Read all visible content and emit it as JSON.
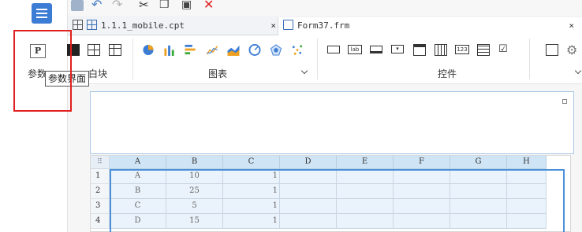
{
  "left_panel": {
    "param_button_glyph": "P",
    "param_label": "参数",
    "tooltip": "参数界面"
  },
  "top_toolbar": {
    "icons": [
      "save-icon",
      "undo-icon",
      "redo-icon",
      "cut-icon",
      "copy-icon",
      "paste-icon",
      "delete-icon"
    ]
  },
  "tabs": [
    {
      "label": "1.1.1_mobile.cpt",
      "close": "×"
    },
    {
      "label": "Form37.frm",
      "close": "×"
    }
  ],
  "ribbon": {
    "groups": [
      {
        "label": "布局块",
        "shown_fragment": "白块"
      },
      {
        "label": "图表"
      },
      {
        "label": "控件"
      }
    ],
    "chart_icons": [
      "pie-chart-icon",
      "bar-chart-icon",
      "horizontal-bar-icon",
      "line-chart-icon",
      "area-chart-icon",
      "gauge-chart-icon",
      "radar-chart-icon",
      "scatter-chart-icon"
    ],
    "widget_icons": [
      "label-widget-icon",
      "lab-widget-icon",
      "textbox-widget-icon",
      "combo-widget-icon",
      "date-widget-icon",
      "calendar-widget-icon",
      "number-widget-icon",
      "list-widget-icon",
      "checkbox-widget-icon",
      "search-icon",
      "gear-icon"
    ],
    "number_widget_text": "123",
    "lab_widget_text": "lab"
  },
  "sheet": {
    "corner": "⠿",
    "columns": [
      "A",
      "B",
      "C",
      "D",
      "E",
      "F",
      "G",
      "H"
    ],
    "rows": [
      {
        "num": "1",
        "cells": [
          "A",
          "10",
          "1",
          "",
          "",
          "",
          "",
          ""
        ]
      },
      {
        "num": "2",
        "cells": [
          "B",
          "25",
          "1",
          "",
          "",
          "",
          "",
          ""
        ]
      },
      {
        "num": "3",
        "cells": [
          "C",
          "5",
          "1",
          "",
          "",
          "",
          "",
          ""
        ]
      },
      {
        "num": "4",
        "cells": [
          "D",
          "15",
          "1",
          "",
          "",
          "",
          "",
          ""
        ]
      }
    ]
  }
}
